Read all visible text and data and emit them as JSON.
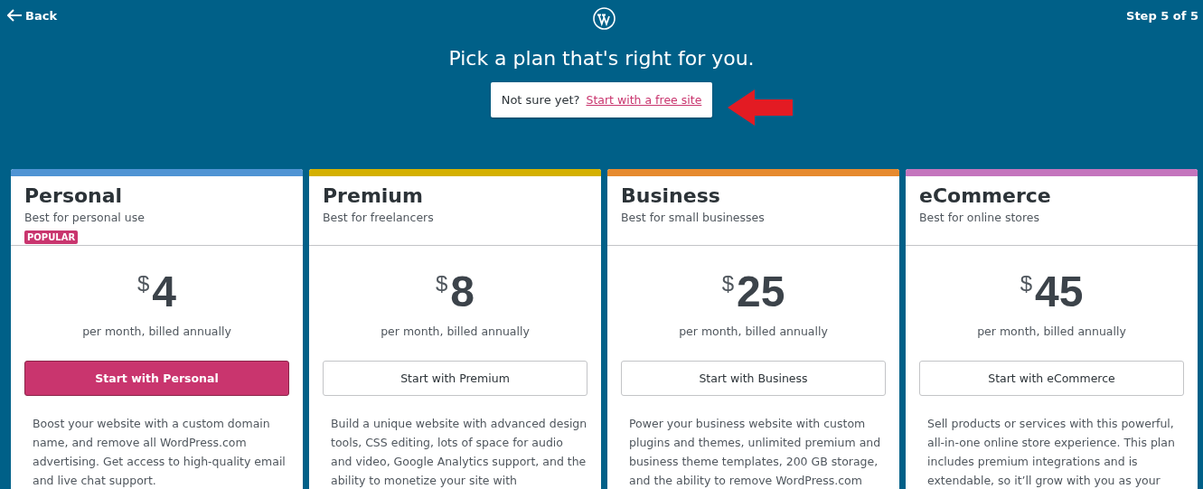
{
  "header": {
    "back": "Back",
    "step": "Step 5 of 5",
    "title": "Pick a plan that's right for you."
  },
  "notice": {
    "text": "Not sure yet?",
    "link": "Start with a free site"
  },
  "plans": [
    {
      "name": "Personal",
      "tagline": "Best for personal use",
      "badge": "POPULAR",
      "color": "#4f94d4",
      "currency": "$",
      "price": "4",
      "period": "per month, billed annually",
      "button": "Start with Personal",
      "highlighted": true,
      "description": "Boost your website with a custom domain name, and remove all WordPress.com advertising. Get access to high-quality email and live chat support."
    },
    {
      "name": "Premium",
      "tagline": "Best for freelancers",
      "color": "#d4b000",
      "currency": "$",
      "price": "8",
      "period": "per month, billed annually",
      "button": "Start with Premium",
      "highlighted": false,
      "description": "Build a unique website with advanced design tools, CSS editing, lots of space for audio and video, Google Analytics support, and the ability to monetize your site with"
    },
    {
      "name": "Business",
      "tagline": "Best for small businesses",
      "color": "#e68a2e",
      "currency": "$",
      "price": "25",
      "period": "per month, billed annually",
      "button": "Start with Business",
      "highlighted": false,
      "description": "Power your business website with custom plugins and themes, unlimited premium and business theme templates, 200 GB storage, and the ability to remove WordPress.com"
    },
    {
      "name": "eCommerce",
      "tagline": "Best for online stores",
      "color": "#c475bd",
      "currency": "$",
      "price": "45",
      "period": "per month, billed annually",
      "button": "Start with eCommerce",
      "highlighted": false,
      "description": "Sell products or services with this powerful, all-in-one online store experience. This plan includes premium integrations and is extendable, so it’ll grow with you as your"
    }
  ]
}
